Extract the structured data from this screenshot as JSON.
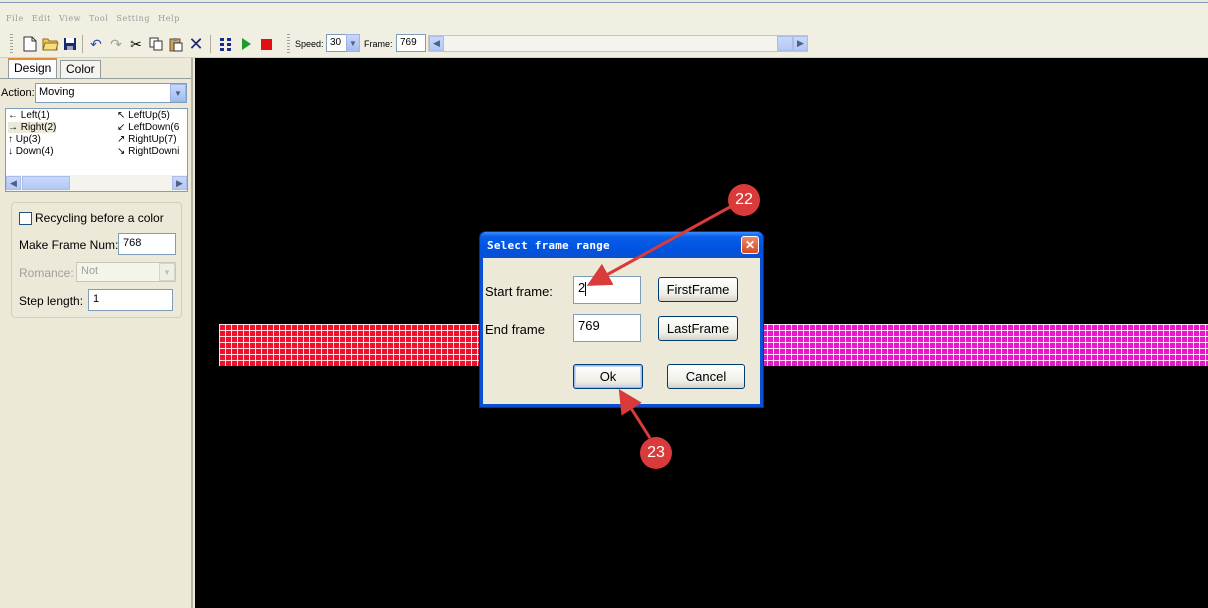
{
  "menu": [
    "File",
    "Edit",
    "View",
    "Tool",
    "Setting",
    "Help"
  ],
  "toolbar": {
    "speed_label": "Speed:",
    "speed_value": "30",
    "frame_label": "Frame:",
    "frame_value": "769"
  },
  "tabs": [
    "Design",
    "Color"
  ],
  "panel": {
    "action_label": "Action:",
    "action_value": "Moving",
    "directions_left": [
      "Left(1)",
      "Right(2)",
      "Up(3)",
      "Down(4)"
    ],
    "directions_right": [
      "LeftUp(5)",
      "LeftDown(6",
      "RightUp(7)",
      "RightDowni"
    ],
    "recycling_label": "Recycling before a color",
    "make_frame_label": "Make Frame Num:",
    "make_frame_value": "768",
    "romance_label": "Romance:",
    "romance_value": "Not",
    "step_label": "Step length:",
    "step_value": "1"
  },
  "dialog": {
    "title": "Select frame range",
    "start_label": "Start frame:",
    "start_value": "2",
    "end_label": "End frame",
    "end_value": "769",
    "first_btn": "FirstFrame",
    "last_btn": "LastFrame",
    "ok_btn": "Ok",
    "cancel_btn": "Cancel"
  },
  "callouts": [
    "22",
    "23"
  ],
  "colors": {
    "strip_left": "#f20f2a",
    "strip_right": "#e917c9",
    "callout": "#d93a3a",
    "titlebar": "#0054e3"
  }
}
